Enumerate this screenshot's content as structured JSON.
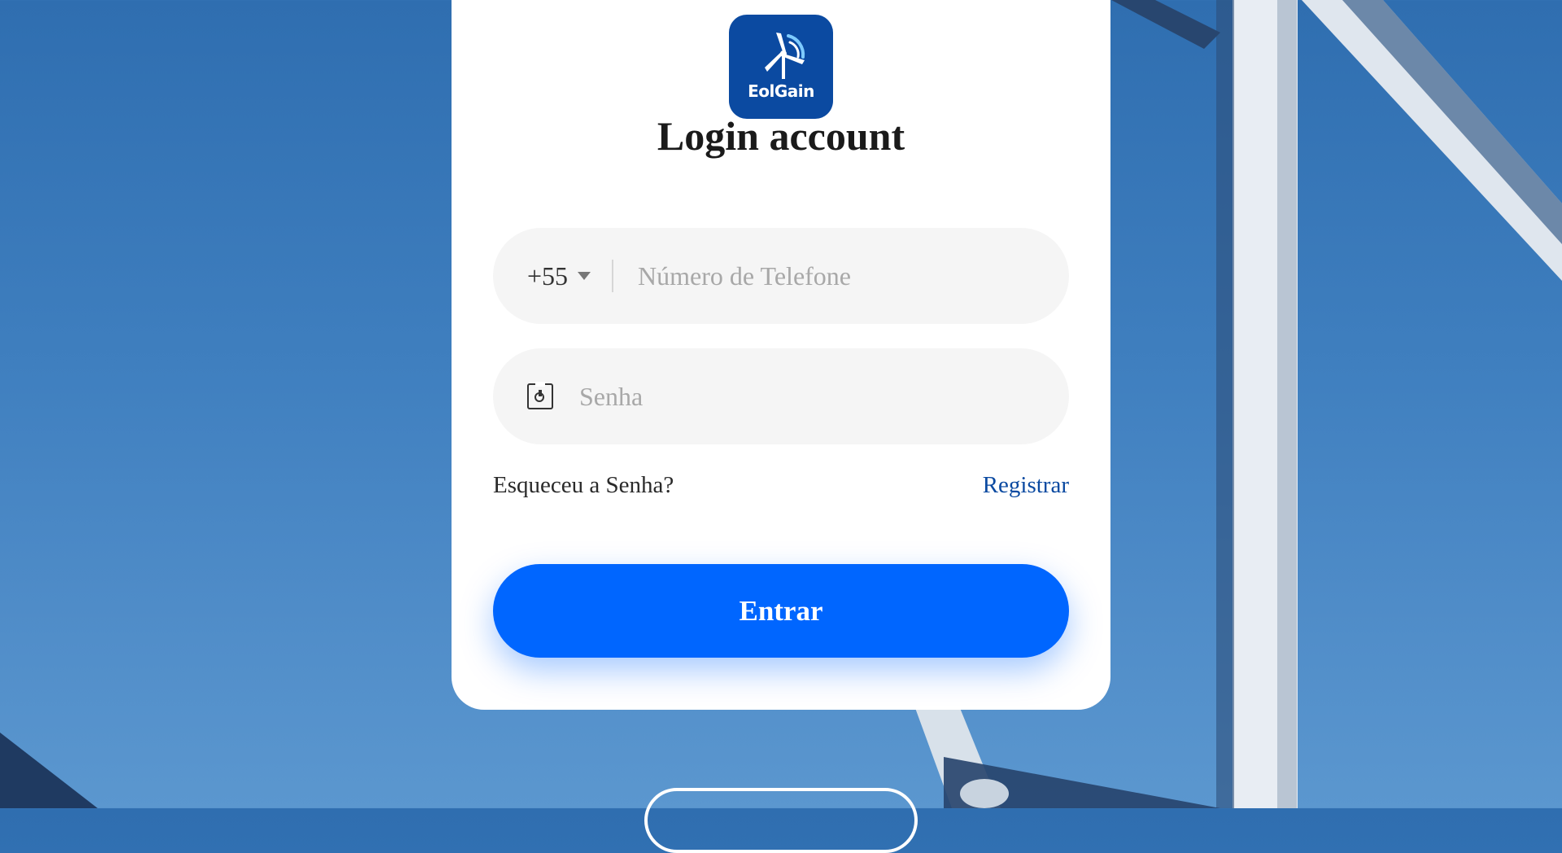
{
  "brand": {
    "name": "EolGain",
    "logo_bg": "#0b4aa1"
  },
  "page": {
    "title": "Login account"
  },
  "phone": {
    "country_code": "+55",
    "placeholder": "Número de Telefone",
    "value": ""
  },
  "password": {
    "placeholder": "Senha",
    "value": ""
  },
  "links": {
    "forgot": "Esqueceu a Senha?",
    "register": "Registrar"
  },
  "actions": {
    "login_label": "Entrar",
    "primary_color": "#0066ff"
  },
  "icons": {
    "logo": "wind-turbine-icon",
    "country_dropdown": "chevron-down-icon",
    "password": "lock-icon"
  }
}
